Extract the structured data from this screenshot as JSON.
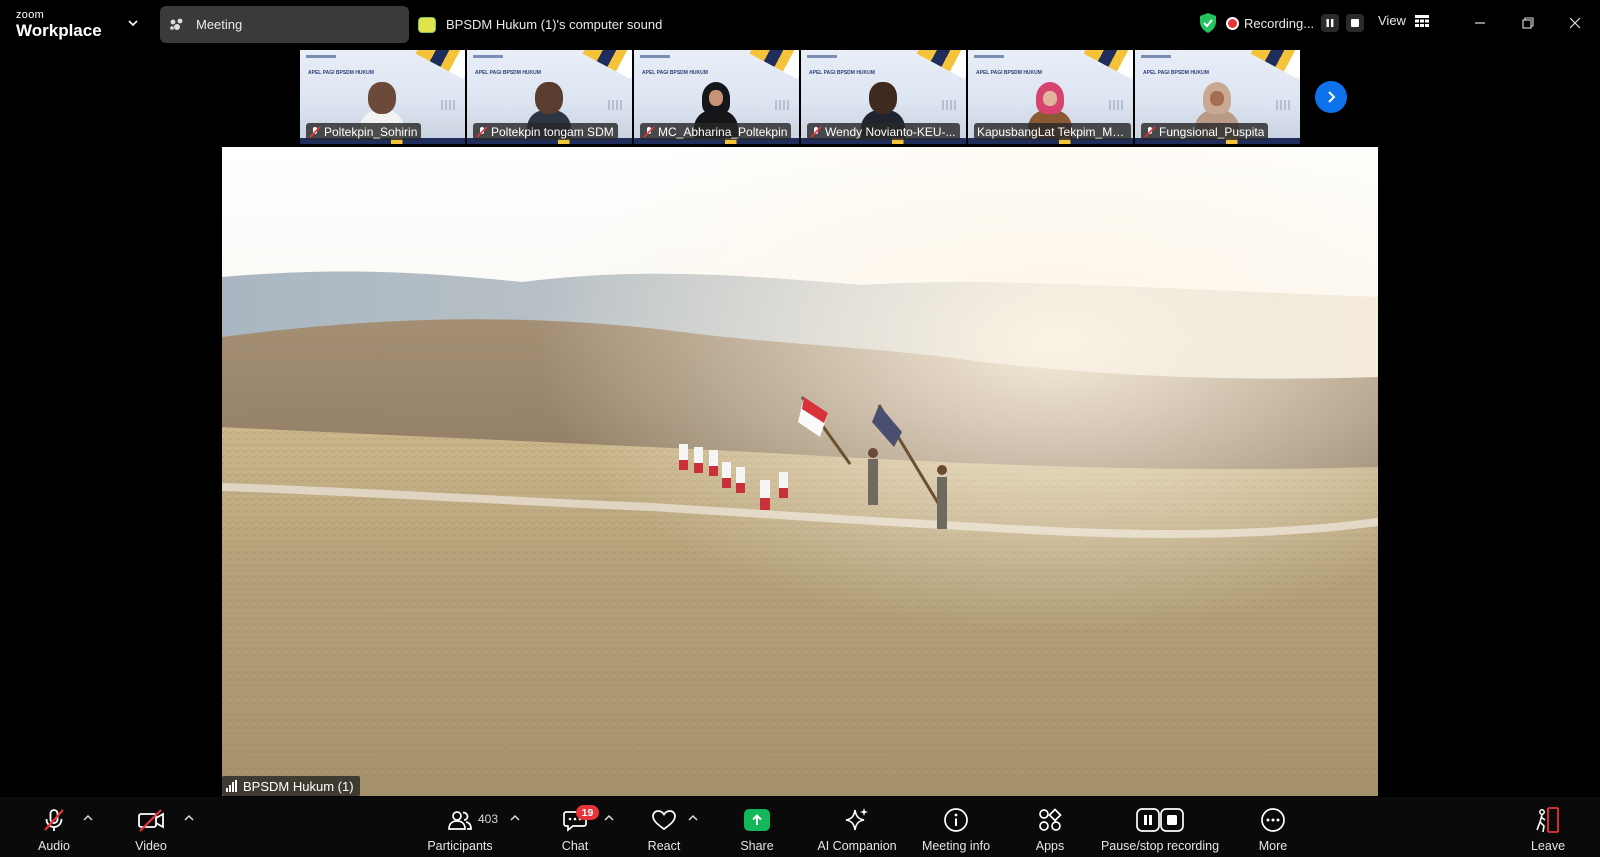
{
  "app": {
    "brand_top": "zoom",
    "brand_bottom": "Workplace"
  },
  "tabs": {
    "meeting": "Meeting",
    "computer_sound": "BPSDM Hukum (1)'s computer sound"
  },
  "recording": {
    "status": "Recording..."
  },
  "view": {
    "label": "View"
  },
  "participants_strip": [
    {
      "name": "Poltekpin_Sohirin",
      "thumb_slide": "APEL PAGI BPSDM HUKUM"
    },
    {
      "name": "Poltekpin tongam SDM",
      "thumb_slide": "APEL PAGI BPSDM HUKUM"
    },
    {
      "name": "MC_Abharina_Poltekpin",
      "thumb_slide": "APEL PAGI BPSDM HUKUM"
    },
    {
      "name": "Wendy Novianto-KEU-...",
      "thumb_slide": "APEL PAGI BPSDM HUKUM"
    },
    {
      "name": "KapusbangLat Tekpim_Mu...",
      "thumb_slide": "APEL PAGI BPSDM HUKUM"
    },
    {
      "name": "Fungsional_Puspita",
      "thumb_slide": "APEL PAGI BPSDM HUKUM"
    }
  ],
  "main_video": {
    "speaker": "BPSDM Hukum (1)"
  },
  "toolbar": {
    "audio": "Audio",
    "video": "Video",
    "participants": "Participants",
    "participants_count": "403",
    "chat": "Chat",
    "chat_badge": "19",
    "react": "React",
    "share": "Share",
    "ai_companion": "AI Companion",
    "meeting_info": "Meeting info",
    "apps": "Apps",
    "pause_stop_recording": "Pause/stop recording",
    "more": "More",
    "leave": "Leave"
  },
  "colors": {
    "accent_blue": "#0e72ed",
    "recording_red": "#e8333a",
    "share_green": "#12b85a",
    "shield_green": "#23c45e"
  }
}
